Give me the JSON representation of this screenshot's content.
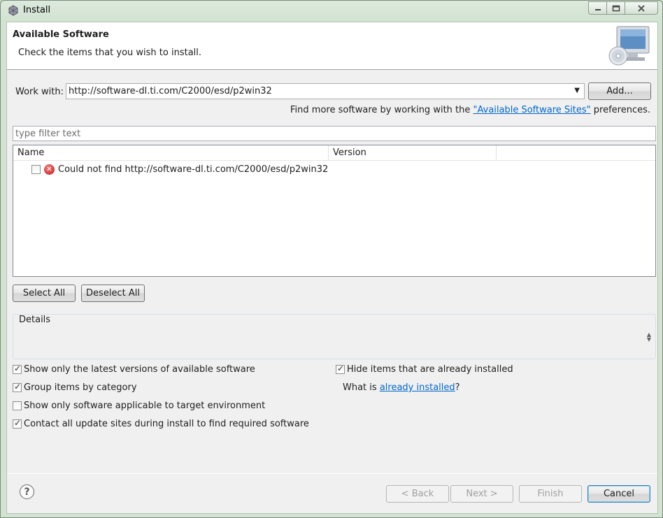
{
  "window": {
    "title": "Install"
  },
  "banner": {
    "title": "Available Software",
    "subtitle": "Check the items that you wish to install."
  },
  "work_with": {
    "label": "Work with:",
    "value": "http://software-dl.ti.com/C2000/esd/p2win32",
    "add_label": "Add..."
  },
  "find_more": {
    "prefix": "Find more software by working with the ",
    "link": "\"Available Software Sites\"",
    "suffix": " preferences."
  },
  "filter": {
    "placeholder": "type filter text"
  },
  "tree": {
    "columns": [
      "Name",
      "Version",
      ""
    ],
    "rows": [
      {
        "checked": false,
        "icon": "error-icon",
        "text": "Could not find http://software-dl.ti.com/C2000/esd/p2win32"
      }
    ]
  },
  "selection": {
    "select_all": "Select All",
    "deselect_all": "Deselect All"
  },
  "details": {
    "label": "Details"
  },
  "options": {
    "latest_versions": {
      "label": "Show only the latest versions of available software",
      "checked": true
    },
    "group_by_category": {
      "label": "Group items by category",
      "checked": true
    },
    "target_env": {
      "label": "Show only software applicable to target environment",
      "checked": false
    },
    "contact_sites": {
      "label": "Contact all update sites during install to find required software",
      "checked": true
    },
    "hide_installed": {
      "label": "Hide items that are already installed",
      "checked": true
    },
    "what_is": {
      "prefix": "What is ",
      "link": "already installed",
      "suffix": "?"
    }
  },
  "footer": {
    "help": "?",
    "back": "< Back",
    "next": "Next >",
    "finish": "Finish",
    "cancel": "Cancel"
  }
}
